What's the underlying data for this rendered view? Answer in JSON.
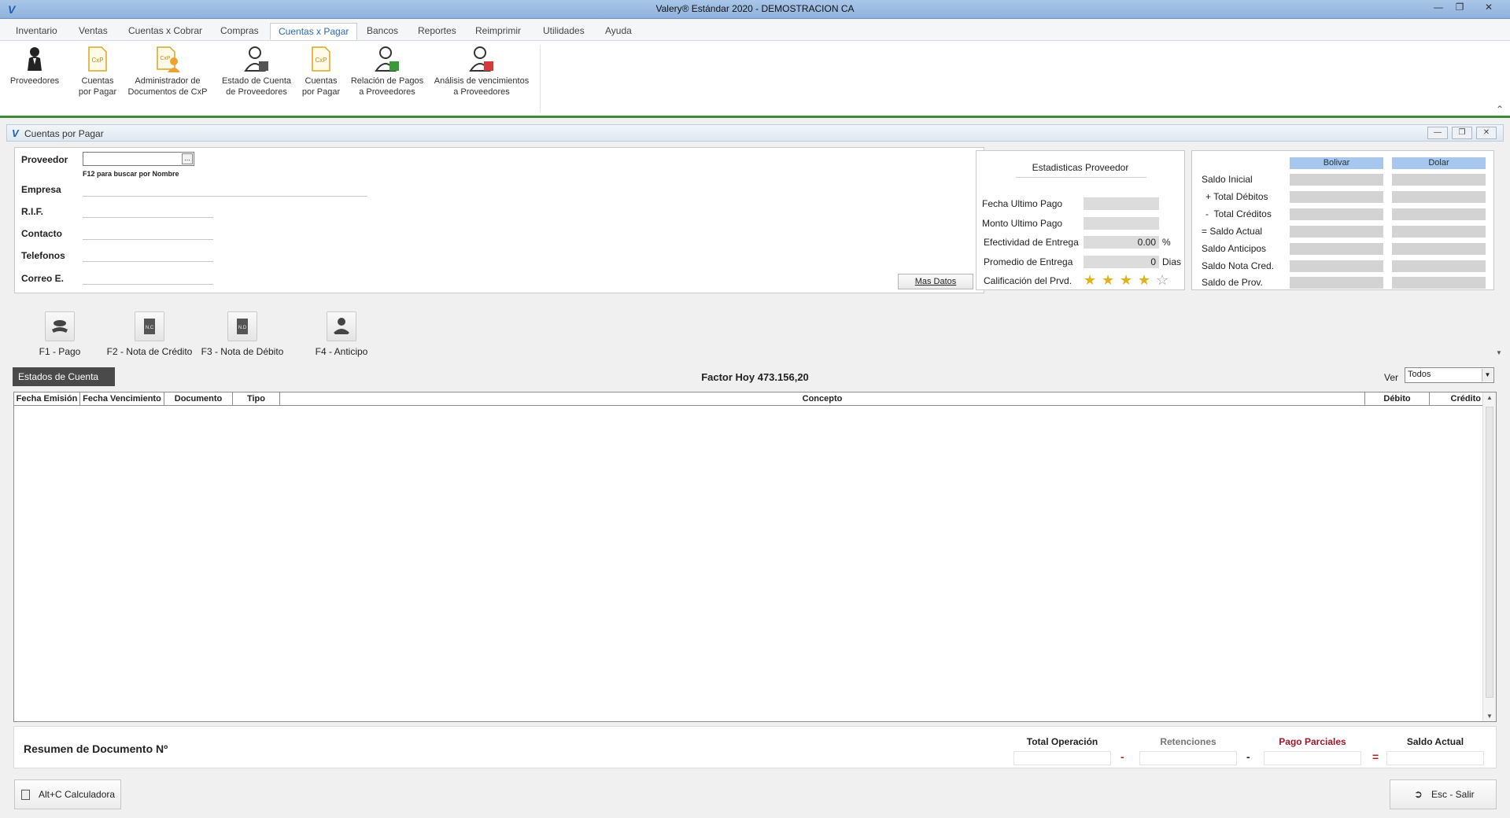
{
  "window": {
    "title": "Valery® Estándar 2020 - DEMOSTRACION CA",
    "controls": [
      "minimize-icon",
      "restore-icon",
      "close-icon"
    ]
  },
  "menu": {
    "tabs": [
      "Inventario",
      "Ventas",
      "Cuentas x Cobrar",
      "Compras",
      "Cuentas x Pagar",
      "Bancos",
      "Reportes",
      "Reimprimir",
      "Utilidades",
      "Ayuda"
    ],
    "active": "Cuentas x Pagar"
  },
  "ribbon": {
    "buttons": [
      {
        "line1": "Proveedores",
        "line2": "",
        "icon": "supplier-person-icon"
      },
      {
        "line1": "Cuentas",
        "line2": "por Pagar",
        "icon": "cxp-document-icon"
      },
      {
        "line1": "Administrador de",
        "line2": "Documentos de CxP",
        "icon": "cxp-admin-icon"
      },
      {
        "line1": "Estado de Cuenta",
        "line2": "de Proveedores",
        "icon": "account-statement-icon"
      },
      {
        "line1": "Cuentas",
        "line2": "por Pagar",
        "icon": "cxp-document-icon"
      },
      {
        "line1": "Relación de Pagos",
        "line2": "a Proveedores",
        "icon": "payments-relation-icon"
      },
      {
        "line1": "Análisis de vencimientos",
        "line2": "a Proveedores",
        "icon": "due-analysis-icon"
      }
    ]
  },
  "child_window": {
    "title": "Cuentas por Pagar"
  },
  "provider": {
    "labels": {
      "proveedor": "Proveedor",
      "empresa": "Empresa",
      "rif": "R.I.F.",
      "contacto": "Contacto",
      "telefonos": "Telefonos",
      "correo": "Correo E."
    },
    "hint": "F12 para buscar por Nombre",
    "ellipsis": "...",
    "mas_datos": "Mas Datos"
  },
  "stats": {
    "title": "Estadisticas Proveedor",
    "fecha_ultimo_pago": "Fecha Ultimo Pago",
    "monto_ultimo_pago": "Monto Ultimo Pago",
    "efectividad_label": "Efectividad de Entrega",
    "efectividad_value": "0.00",
    "efectividad_unit": "%",
    "promedio_label": "Promedio de Entrega",
    "promedio_value": "0",
    "promedio_unit": "Dias",
    "calificacion_label": "Calificación del Prvd.",
    "rating": 4,
    "rating_max": 5,
    "star_color": "#e0b21c"
  },
  "balances": {
    "headers": [
      "Bolivar",
      "Dolar"
    ],
    "rows": [
      "Saldo Inicial",
      "+ Total Débitos",
      "-  Total Créditos",
      "= Saldo Actual",
      "Saldo Anticipos",
      "Saldo Nota Cred.",
      "Saldo de Prov."
    ]
  },
  "actions": [
    {
      "label": "F1 - Pago",
      "icon": "payment-hand-icon"
    },
    {
      "label": "F2 - Nota de Crédito",
      "icon": "credit-note-icon"
    },
    {
      "label": "F3 - Nota de Débito",
      "icon": "debit-note-icon"
    },
    {
      "label": "F4 - Anticipo",
      "icon": "advance-payment-icon"
    }
  ],
  "statement": {
    "tab": "Estados de Cuenta",
    "factor_label": "Factor Hoy",
    "factor_value": "473.156,20",
    "ver_label": "Ver",
    "ver_value": "Todos"
  },
  "grid": {
    "columns": [
      "Fecha Emisión",
      "Fecha Vencimiento",
      "Documento",
      "Tipo",
      "Concepto",
      "Débito",
      "Crédito"
    ],
    "rows": []
  },
  "summary": {
    "title": "Resumen de Documento Nº",
    "labels": [
      "Total Operación",
      "Retenciones",
      "Pago Parciales",
      "Saldo Actual"
    ],
    "operators": [
      "-",
      "-",
      "="
    ],
    "label_colors": [
      "#222222",
      "#777777",
      "#a0182a",
      "#222222"
    ]
  },
  "footer": {
    "calc": "Alt+C Calculadora",
    "exit": "Esc - Salir"
  }
}
